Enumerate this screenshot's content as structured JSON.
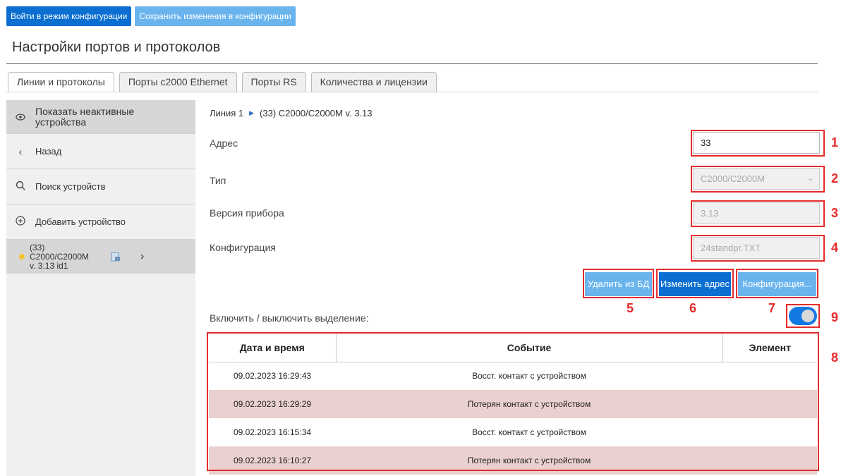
{
  "toolbar": {
    "enter_config_label": "Войти в режим конфигурации",
    "save_config_label": "Сохранить изменения в конфигурации"
  },
  "page": {
    "title": "Настройки портов и протоколов"
  },
  "tabs": [
    {
      "label": "Линии и протоколы",
      "active": true
    },
    {
      "label": "Порты c2000 Ethernet",
      "active": false
    },
    {
      "label": "Порты RS",
      "active": false
    },
    {
      "label": "Количества и лицензии",
      "active": false
    }
  ],
  "sidebar": {
    "show_inactive_label": "Показать неактивные устройства",
    "back_label": "Назад",
    "search_label": "Поиск устройств",
    "add_label": "Добавить устройство",
    "device_label": "(33) C2000/C2000M v. 3.13 id1",
    "device_status_color": "#f3c431"
  },
  "breadcrumb": {
    "line": "Линия 1",
    "device": "(33) C2000/C2000M v. 3.13"
  },
  "form": {
    "address_label": "Адрес",
    "address_value": "33",
    "type_label": "Тип",
    "type_value": "C2000/C2000M",
    "version_label": "Версия прибора",
    "version_value": "3.13",
    "config_label": "Конфигурация",
    "config_value": "24standpr.TXT"
  },
  "actions": {
    "delete_label": "Удалить из БД",
    "change_address_label": "Изменить адрес",
    "configuration_label": "Конфигурация..."
  },
  "highlight": {
    "label": "Включить / выключить выделение:",
    "enabled": true
  },
  "annotations": [
    "1",
    "2",
    "3",
    "4",
    "5",
    "6",
    "7",
    "8",
    "9"
  ],
  "events": {
    "columns": [
      "Дата и время",
      "Событие",
      "Элемент"
    ],
    "rows": [
      {
        "datetime": "09.02.2023 16:29:43",
        "event": "Восст. контакт с устройством",
        "element": ""
      },
      {
        "datetime": "09.02.2023 16:29:29",
        "event": "Потерян контакт с устройством",
        "element": ""
      },
      {
        "datetime": "09.02.2023 16:15:34",
        "event": "Восст. контакт с устройством",
        "element": ""
      },
      {
        "datetime": "09.02.2023 16:10:27",
        "event": "Потерян контакт с устройством",
        "element": ""
      }
    ]
  },
  "colors": {
    "primary_button": "#0a6fd1",
    "disabled_button": "#6ab4ee",
    "annotation_red": "#e52b2b",
    "lost_row": "#ead0d0",
    "toggle_on": "#1279e4"
  }
}
